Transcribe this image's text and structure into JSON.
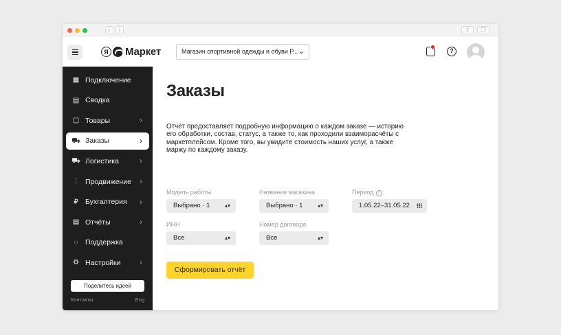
{
  "header": {
    "logo_text": "Маркет",
    "logo_ya": "Я",
    "shop_select": "Магазин спортивной одежды и обуви Р...",
    "icons": [
      "menu-icon",
      "bell-icon",
      "help-icon",
      "avatar"
    ]
  },
  "sidebar": {
    "items": [
      {
        "label": "Подключение",
        "icon": "store-icon",
        "glyph": "▦",
        "chevron": false,
        "active": false
      },
      {
        "label": "Сводка",
        "icon": "dashboard-icon",
        "glyph": "▤",
        "chevron": false,
        "active": false
      },
      {
        "label": "Товары",
        "icon": "products-icon",
        "glyph": "▢",
        "chevron": true,
        "active": false
      },
      {
        "label": "Заказы",
        "icon": "cart-icon",
        "glyph": "⛟",
        "chevron": true,
        "active": true
      },
      {
        "label": "Логистика",
        "icon": "truck-icon",
        "glyph": "⛟",
        "chevron": true,
        "active": false
      },
      {
        "label": "Продвижение",
        "icon": "chart-icon",
        "glyph": "⫶",
        "chevron": true,
        "active": false
      },
      {
        "label": "Бухгалтерия",
        "icon": "ruble-icon",
        "glyph": "₽",
        "chevron": true,
        "active": false
      },
      {
        "label": "Отчёты",
        "icon": "report-icon",
        "glyph": "▤",
        "chevron": true,
        "active": false
      },
      {
        "label": "Поддержка",
        "icon": "chat-icon",
        "glyph": "◌",
        "chevron": false,
        "active": false
      },
      {
        "label": "Настройки",
        "icon": "gear-icon",
        "glyph": "⚙",
        "chevron": true,
        "active": false
      }
    ],
    "share_label": "Поделитесь идеей",
    "contacts": "Контакты",
    "lang": "Eng"
  },
  "main": {
    "title": "Заказы",
    "description": "Отчёт предоставляет подробную информацию о каждом заказе — историю его обработки, состав, статус, а также то, как проходили взаиморасчёты с маркетплейсом. Кроме того, вы увидите стоимость наших услуг, а также маржу по каждому заказу.",
    "filters": {
      "model_label": "Модель работы",
      "model_value": "Выбрано · 1",
      "shop_label": "Название магазина",
      "shop_value": "Выбрано · 1",
      "period_label": "Период",
      "period_value": "1.05.22–31.05.22",
      "inn_label": "ИНН",
      "inn_value": "Все",
      "contract_label": "Номер договора",
      "contract_value": "Все"
    },
    "submit_label": "Сформировать отчёт"
  },
  "colors": {
    "sidebar_bg": "#1e1e1e",
    "accent_yellow": "#fed42b",
    "notification_red": "#f51a1a"
  }
}
